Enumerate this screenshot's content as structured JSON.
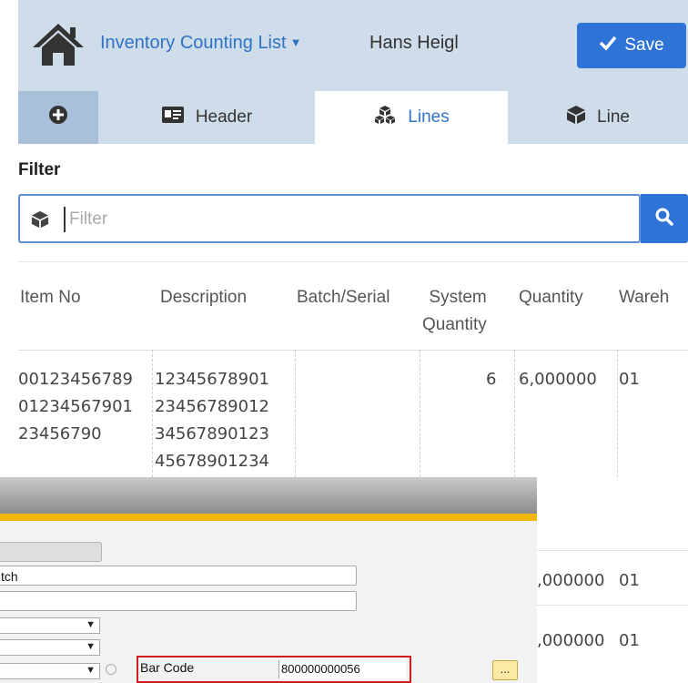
{
  "topbar": {
    "title": "Inventory Counting List",
    "user": "Hans Heigl",
    "save_label": "Save"
  },
  "tabs": {
    "header_label": "Header",
    "lines_label": "Lines",
    "line_label": "Line"
  },
  "filter": {
    "label": "Filter",
    "placeholder": "Filter"
  },
  "table": {
    "headers": {
      "item_no": "Item No",
      "description": "Description",
      "batch_serial": "Batch/Serial",
      "system_quantity": "System\nQuantity",
      "quantity": "Quantity",
      "warehouse": "Wareh"
    },
    "row1": {
      "item_no": "00123456789\n01234567901\n23456790",
      "description": "12345678901\n23456789012\n34567890123\n45678901234",
      "batch_serial": "",
      "system_quantity": "6",
      "quantity": "6,000000",
      "warehouse": "01"
    },
    "row2": {
      "quantity": ",000000",
      "warehouse": "01"
    },
    "row3": {
      "quantity": ",000000",
      "warehouse": "01"
    }
  },
  "dialog": {
    "field1_value": "tch",
    "field2_value": "",
    "bar_code_label": "Bar Code",
    "bar_code_value": "800000000056",
    "ellipsis_label": "..."
  },
  "colors": {
    "topbar_bg": "#cfdcea",
    "accent_blue": "#2f73d6",
    "dialog_accent": "#f2b70d",
    "highlight_red": "#d01c1c"
  }
}
